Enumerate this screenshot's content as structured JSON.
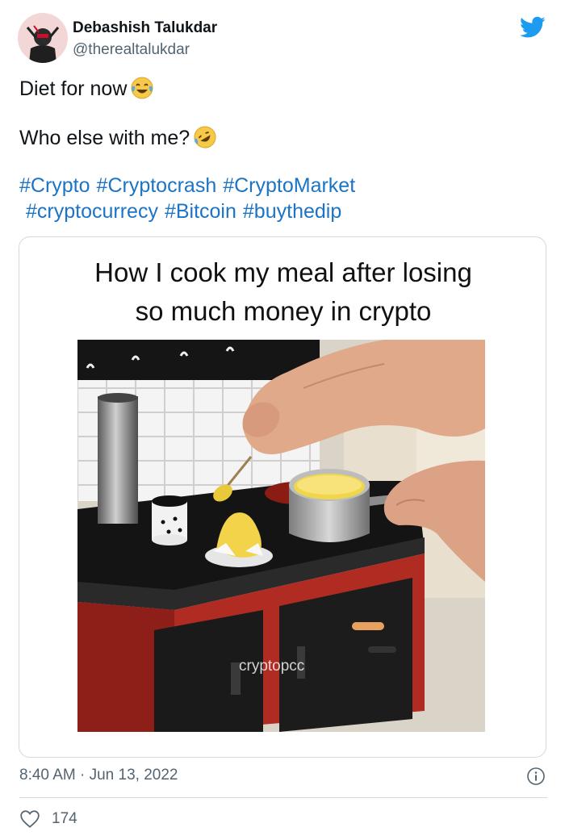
{
  "author": {
    "name": "Debashish Talukdar",
    "handle": "@therealtalukdar"
  },
  "tweet": {
    "line1": "Diet for now",
    "line1_emoji": "face-with-tears-of-joy-emoji",
    "line2": "Who else with me?",
    "line2_emoji": "rolling-on-floor-laughing-emoji",
    "hashtags_row1": [
      "#Crypto",
      "#Cryptocrash",
      "#CryptoMarket"
    ],
    "hashtags_row2": [
      "#cryptocurrecy",
      "#Bitcoin",
      "#buythedip"
    ]
  },
  "media": {
    "caption_line1": "How I cook my meal after losing",
    "caption_line2": "so much money in crypto",
    "watermark": "cryptopcc"
  },
  "meta": {
    "timestamp": "8:40 AM · Jun 13, 2022",
    "like_count": "174"
  },
  "icons": {
    "brand": "twitter-bird-icon",
    "info": "info-icon",
    "like": "heart-icon"
  },
  "colors": {
    "hashtag": "#1b74c4",
    "twitter_blue": "#1d9bf0",
    "muted": "#536471",
    "border": "#cfd9de"
  }
}
